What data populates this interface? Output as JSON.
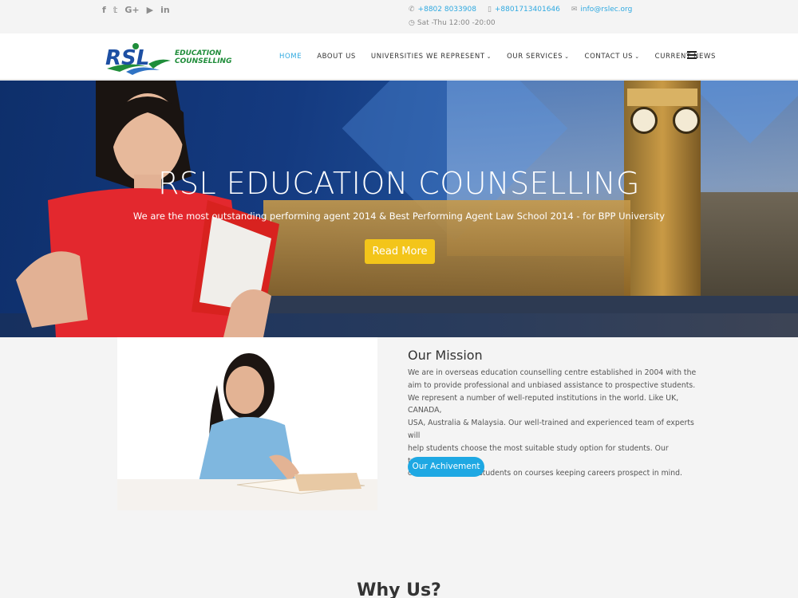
{
  "topbar": {
    "social_icons": [
      {
        "name": "facebook-icon",
        "glyph": "f"
      },
      {
        "name": "twitter-icon",
        "glyph": "𝕥"
      },
      {
        "name": "google-plus-icon",
        "glyph": "G+"
      },
      {
        "name": "youtube-icon",
        "glyph": "▶"
      },
      {
        "name": "linkedin-icon",
        "glyph": "in"
      }
    ],
    "phone": "+8802 8033908",
    "mobile": "+8801713401646",
    "email": "info@rslec.org",
    "hours": "Sat -Thu 12:00 -20:00"
  },
  "brand": {
    "logo_mark": "RSL",
    "line1": "EDUCATION",
    "line2": "COUNSELLING"
  },
  "nav": {
    "home": "HOME",
    "about": "ABOUT US",
    "universities": "UNIVERSITIES WE REPRESENT",
    "services": "OUR SERVICES",
    "contact": "CONTACT US",
    "news": "CURRENT NEWS"
  },
  "hero": {
    "title": "RSL EDUCATION COUNSELLING",
    "subtitle": "We are the most outstanding performing agent 2014 & Best Performing Agent Law School 2014 - for BPP University",
    "button": "Read More"
  },
  "mission": {
    "title": "Our Mission",
    "para1_line1": "We are in overseas education counselling centre established in 2004 with the",
    "para1_line2": "aim to provide professional and unbiased assistance to prospective students.",
    "para2_line1": "We represent a number of well-reputed institutions in the world. Like UK, CANADA,",
    "para2_line2": "USA, Australia & Malaysia. Our well-trained and experienced team of experts will",
    "para2_line3": "help students choose the most suitable study option for students. Our trained",
    "para2_line4": "counsellors advise students on courses keeping careers prospect in mind.",
    "button": "Our Achivement"
  },
  "why": {
    "title": "Why Us?"
  },
  "colors": {
    "accent_blue": "#1ea8e3",
    "button_yellow": "#f3c51a",
    "brand_green": "#1f8d3a",
    "brand_blue": "#1d4fa3"
  }
}
